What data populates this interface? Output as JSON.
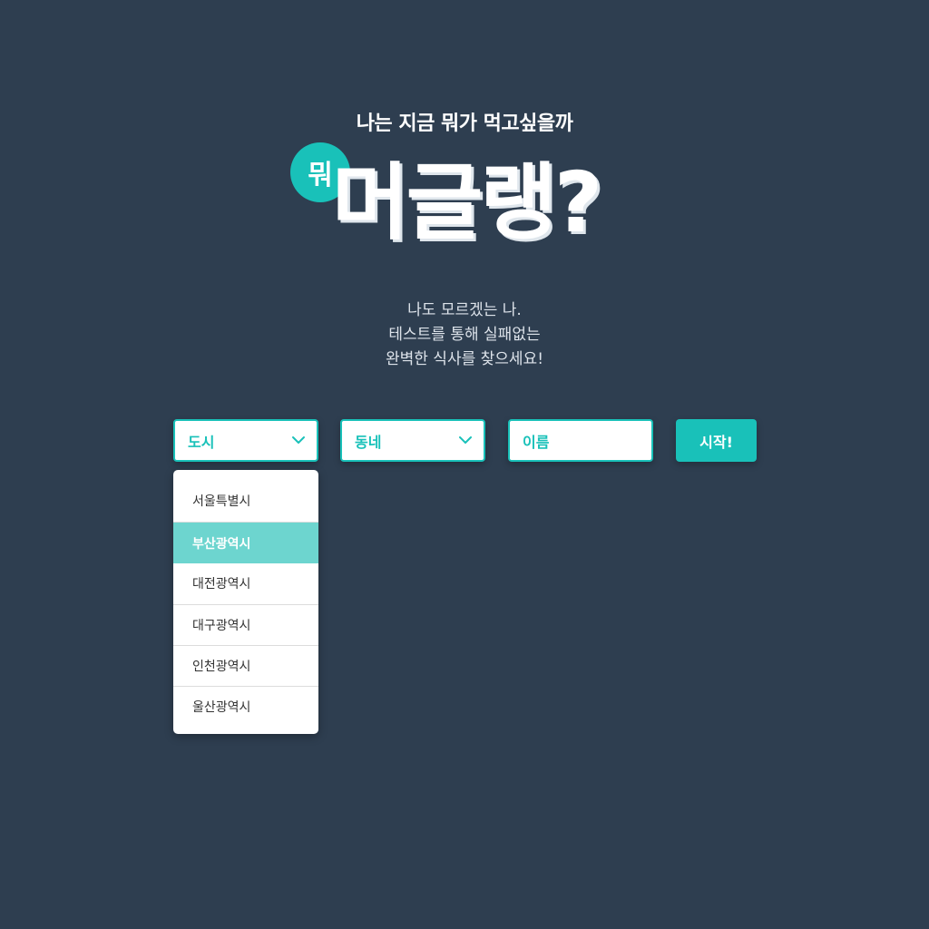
{
  "header": {
    "tagline": "나는 지금 뭐가 먹고싶을까",
    "logo_badge": "뭐",
    "logo_main": "머글랭?"
  },
  "description": {
    "lines": [
      "나도 모르겠는 나.",
      "테스트를 통해 실패없는",
      "완벽한 식사를 찾으세요!"
    ]
  },
  "form": {
    "city_label": "도시",
    "town_label": "동네",
    "name_placeholder": "이름",
    "start_label": "시작!"
  },
  "city_options": [
    {
      "label": "서울특별시",
      "selected": false
    },
    {
      "label": "부산광역시",
      "selected": true
    },
    {
      "label": "대전광역시",
      "selected": false
    },
    {
      "label": "대구광역시",
      "selected": false
    },
    {
      "label": "인천광역시",
      "selected": false
    },
    {
      "label": "울산광역시",
      "selected": false
    }
  ],
  "colors": {
    "background": "#2e3e50",
    "accent": "#19c1b9",
    "selected_option": "#6dd5cf"
  },
  "icons": {
    "dropdown": "chevron-down-icon"
  }
}
